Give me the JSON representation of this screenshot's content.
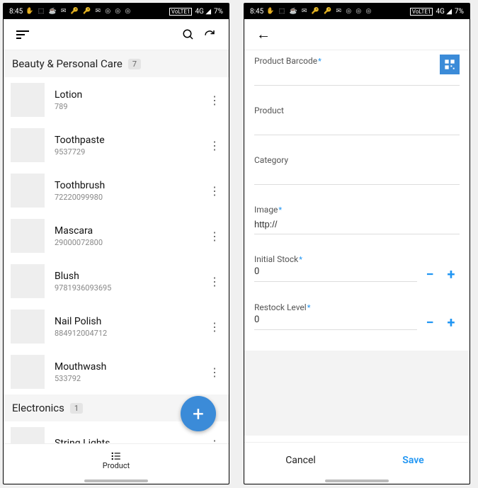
{
  "status": {
    "time": "8:45",
    "icons": "✋ ⬚ ☕ ✉ 🔑 🔑 ✉ ◎ ◎ ◎",
    "net": "VoLTE1",
    "sig": "4G ◢",
    "battery": "7%"
  },
  "listScreen": {
    "sections": [
      {
        "title": "Beauty & Personal Care",
        "count": "7",
        "items": [
          {
            "name": "Lotion",
            "code": "789"
          },
          {
            "name": "Toothpaste",
            "code": "9537729"
          },
          {
            "name": "Toothbrush",
            "code": "72220099980"
          },
          {
            "name": "Mascara",
            "code": "29000072800"
          },
          {
            "name": "Blush",
            "code": "9781936093695"
          },
          {
            "name": "Nail Polish",
            "code": "884912004712"
          },
          {
            "name": "Mouthwash",
            "code": "533792"
          }
        ]
      },
      {
        "title": "Electronics",
        "count": "1",
        "items": [
          {
            "name": "String Lights",
            "code": ""
          }
        ]
      }
    ],
    "bottomNav": {
      "label": "Product"
    }
  },
  "formScreen": {
    "fields": {
      "barcode": {
        "label": "Product Barcode",
        "required": true,
        "value": ""
      },
      "product": {
        "label": "Product",
        "required": false,
        "value": ""
      },
      "category": {
        "label": "Category",
        "required": false,
        "value": ""
      },
      "image": {
        "label": "Image",
        "required": true,
        "value": "http://"
      },
      "initialStock": {
        "label": "Initial Stock",
        "required": true,
        "value": "0"
      },
      "restockLevel": {
        "label": "Restock Level",
        "required": true,
        "value": "0"
      }
    },
    "actions": {
      "cancel": "Cancel",
      "save": "Save"
    }
  }
}
